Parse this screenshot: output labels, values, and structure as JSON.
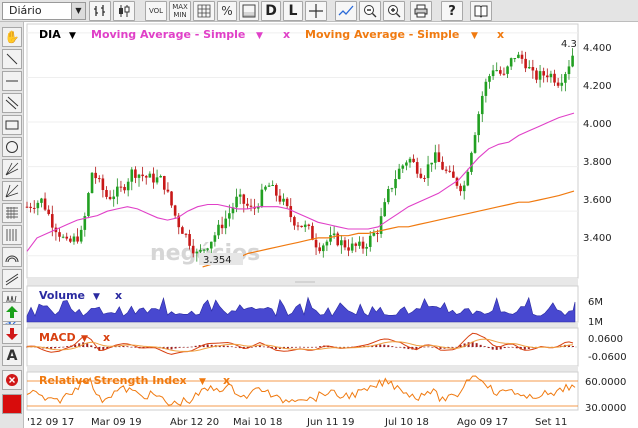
{
  "toolbar": {
    "period": "Diário",
    "buttons": [
      {
        "id": "vol",
        "label": "VOL"
      },
      {
        "id": "maxmin",
        "label": "MAX\nMIN"
      },
      {
        "id": "percent",
        "label": "%"
      },
      {
        "id": "dataseries",
        "label": "D"
      },
      {
        "id": "linear",
        "label": "L"
      }
    ]
  },
  "price_panel": {
    "symbol": "DIA",
    "indicators": [
      {
        "name": "Moving Average - Simple",
        "color": "#e040c8"
      },
      {
        "name": "Moving Average - Simple",
        "color": "#f07a10"
      }
    ],
    "close_label_partial": "4.3",
    "min_label": "3.354",
    "watermark": "negócios",
    "y_ticks": [
      "4.400",
      "4.200",
      "4.000",
      "3.800",
      "3.600",
      "3.400"
    ]
  },
  "volume_panel": {
    "title": "Volume",
    "y_ticks": [
      "6M",
      "1M"
    ],
    "color": "#3a3ac8"
  },
  "macd_panel": {
    "title": "MACD",
    "y_ticks": [
      "0.0600",
      "-0.0600"
    ]
  },
  "rsi_panel": {
    "title": "Relative Strength Index",
    "y_ticks": [
      "60.0000",
      "30.0000"
    ]
  },
  "x_axis": {
    "labels": [
      "'12 09 17",
      "Mar 09 19",
      "Abr 12 20",
      "Mai 10 18",
      "Jun 11 19",
      "Jul 10 18",
      "Ago 09 17",
      "Set 11"
    ]
  },
  "chart_data": {
    "type": "candlestick",
    "y_range": [
      3.3,
      4.44
    ],
    "ma_fast": [
      [
        0,
        3.42
      ],
      [
        10,
        3.48
      ],
      [
        20,
        3.5
      ],
      [
        30,
        3.52
      ],
      [
        40,
        3.54
      ],
      [
        50,
        3.56
      ],
      [
        60,
        3.57
      ],
      [
        70,
        3.58
      ],
      [
        80,
        3.6
      ],
      [
        90,
        3.61
      ],
      [
        100,
        3.62
      ],
      [
        110,
        3.61
      ],
      [
        120,
        3.59
      ],
      [
        130,
        3.57
      ],
      [
        140,
        3.56
      ],
      [
        150,
        3.57
      ],
      [
        160,
        3.6
      ],
      [
        170,
        3.62
      ],
      [
        180,
        3.63
      ],
      [
        190,
        3.63
      ],
      [
        200,
        3.62
      ],
      [
        210,
        3.61
      ],
      [
        220,
        3.61
      ],
      [
        230,
        3.62
      ],
      [
        240,
        3.62
      ],
      [
        250,
        3.62
      ],
      [
        260,
        3.61
      ],
      [
        270,
        3.59
      ],
      [
        280,
        3.57
      ],
      [
        290,
        3.55
      ],
      [
        300,
        3.54
      ],
      [
        310,
        3.53
      ],
      [
        320,
        3.52
      ],
      [
        330,
        3.52
      ],
      [
        340,
        3.52
      ],
      [
        350,
        3.53
      ],
      [
        360,
        3.56
      ],
      [
        370,
        3.59
      ],
      [
        380,
        3.62
      ],
      [
        390,
        3.64
      ],
      [
        400,
        3.66
      ],
      [
        410,
        3.68
      ],
      [
        420,
        3.71
      ],
      [
        430,
        3.74
      ],
      [
        440,
        3.79
      ],
      [
        450,
        3.84
      ],
      [
        460,
        3.88
      ],
      [
        470,
        3.9
      ],
      [
        480,
        3.91
      ],
      [
        490,
        3.94
      ],
      [
        500,
        3.96
      ],
      [
        510,
        3.98
      ],
      [
        520,
        4.0
      ],
      [
        530,
        4.02
      ],
      [
        545,
        4.04
      ]
    ],
    "ma_slow": [
      [
        175,
        3.35
      ],
      [
        190,
        3.37
      ],
      [
        200,
        3.38
      ],
      [
        210,
        3.39
      ],
      [
        220,
        3.41
      ],
      [
        230,
        3.42
      ],
      [
        240,
        3.43
      ],
      [
        250,
        3.44
      ],
      [
        260,
        3.45
      ],
      [
        270,
        3.46
      ],
      [
        280,
        3.47
      ],
      [
        290,
        3.48
      ],
      [
        300,
        3.48
      ],
      [
        310,
        3.49
      ],
      [
        320,
        3.49
      ],
      [
        330,
        3.5
      ],
      [
        340,
        3.5
      ],
      [
        350,
        3.51
      ],
      [
        360,
        3.52
      ],
      [
        370,
        3.53
      ],
      [
        380,
        3.53
      ],
      [
        390,
        3.54
      ],
      [
        400,
        3.55
      ],
      [
        410,
        3.56
      ],
      [
        420,
        3.57
      ],
      [
        430,
        3.58
      ],
      [
        440,
        3.59
      ],
      [
        450,
        3.6
      ],
      [
        460,
        3.61
      ],
      [
        470,
        3.62
      ],
      [
        480,
        3.63
      ],
      [
        490,
        3.64
      ],
      [
        500,
        3.64
      ],
      [
        510,
        3.65
      ],
      [
        520,
        3.66
      ],
      [
        530,
        3.67
      ],
      [
        545,
        3.69
      ]
    ],
    "price_points": [
      [
        0,
        3.62
      ],
      [
        15,
        3.65
      ],
      [
        25,
        3.55
      ],
      [
        40,
        3.45
      ],
      [
        55,
        3.5
      ],
      [
        65,
        3.78
      ],
      [
        80,
        3.66
      ],
      [
        95,
        3.7
      ],
      [
        105,
        3.78
      ],
      [
        120,
        3.75
      ],
      [
        135,
        3.74
      ],
      [
        150,
        3.55
      ],
      [
        160,
        3.48
      ],
      [
        170,
        3.4
      ],
      [
        185,
        3.48
      ],
      [
        200,
        3.58
      ],
      [
        210,
        3.66
      ],
      [
        225,
        3.6
      ],
      [
        240,
        3.72
      ],
      [
        255,
        3.64
      ],
      [
        265,
        3.56
      ],
      [
        280,
        3.52
      ],
      [
        290,
        3.44
      ],
      [
        305,
        3.48
      ],
      [
        320,
        3.44
      ],
      [
        335,
        3.44
      ],
      [
        350,
        3.52
      ],
      [
        360,
        3.68
      ],
      [
        370,
        3.78
      ],
      [
        380,
        3.84
      ],
      [
        395,
        3.76
      ],
      [
        405,
        3.85
      ],
      [
        420,
        3.76
      ],
      [
        435,
        3.7
      ],
      [
        445,
        3.93
      ],
      [
        455,
        4.15
      ],
      [
        465,
        4.25
      ],
      [
        475,
        4.2
      ],
      [
        485,
        4.3
      ],
      [
        495,
        4.28
      ],
      [
        505,
        4.2
      ],
      [
        520,
        4.22
      ],
      [
        530,
        4.18
      ],
      [
        538,
        4.24
      ],
      [
        546,
        4.33
      ]
    ]
  }
}
